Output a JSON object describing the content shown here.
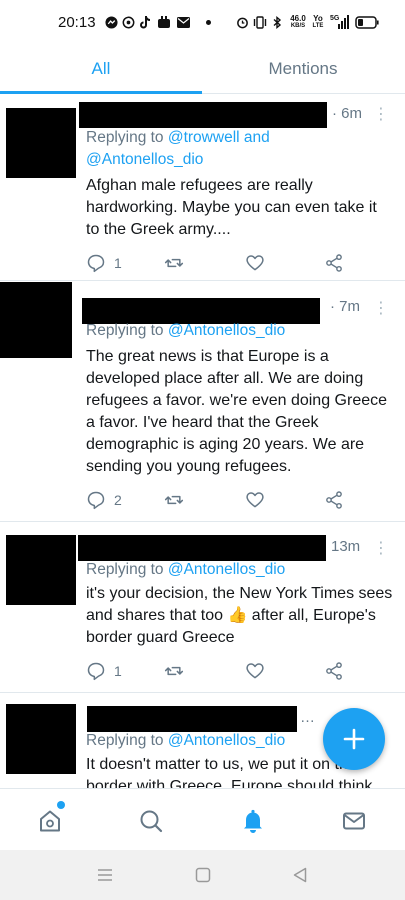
{
  "status_bar": {
    "time": "20:13",
    "net_speed_value": "46.0",
    "net_speed_unit": "KB/S",
    "volte_top": "Yo",
    "volte_bottom": "LTE",
    "network_type": "5G",
    "icons": [
      "messenger-icon",
      "whatsapp-icon",
      "tiktok-icon",
      "game-icon",
      "mail-icon",
      "dot-icon",
      "alarm-icon",
      "vibrate-icon",
      "bluetooth-icon",
      "signal-icon",
      "battery-icon"
    ]
  },
  "tabs": [
    {
      "label": "All",
      "active": true
    },
    {
      "label": "Mentions",
      "active": false
    }
  ],
  "tweets": [
    {
      "time": "6m",
      "replying_prefix": "Replying to ",
      "replying_mentions": "@trowwell and @Antonellos_dio",
      "text": "Afghan male refugees are really hardworking. Maybe you can even take it to the Greek army....",
      "reply_count": "1"
    },
    {
      "time": "7m",
      "replying_prefix": "Replying to ",
      "replying_mentions": "@Antonellos_dio",
      "text": "The great news is that Europe is a developed place after all. We are doing refugees a favor. we're even doing Greece a favor. I've heard that the Greek demographic is aging 20 years. We are sending you young refugees.",
      "reply_count": "2"
    },
    {
      "time": "13m",
      "replying_prefix": "Replying to ",
      "replying_mentions": "@Antonellos_dio",
      "text_before_emoji": "it's your decision, the New York Times sees and shares that too ",
      "emoji": "👍",
      "text_after_emoji": " after all, Europe's border guard Greece",
      "reply_count": "1"
    },
    {
      "time": "…",
      "replying_prefix": "Replying to ",
      "replying_mentions": "@Antonellos_dio",
      "text": "It doesn't matter to us, we put it on the border with Greece. Europe should think"
    }
  ],
  "fab": {
    "icon": "plus-icon"
  },
  "bottom_nav": [
    "home-icon",
    "search-icon",
    "notifications-icon",
    "messages-icon"
  ],
  "android_nav": [
    "menu-icon",
    "home-square-icon",
    "back-icon"
  ],
  "colors": {
    "accent": "#1da1f2",
    "secondary_text": "#657786",
    "primary_text": "#14171a",
    "divider": "#e1e8ed",
    "redaction": "#000000"
  }
}
